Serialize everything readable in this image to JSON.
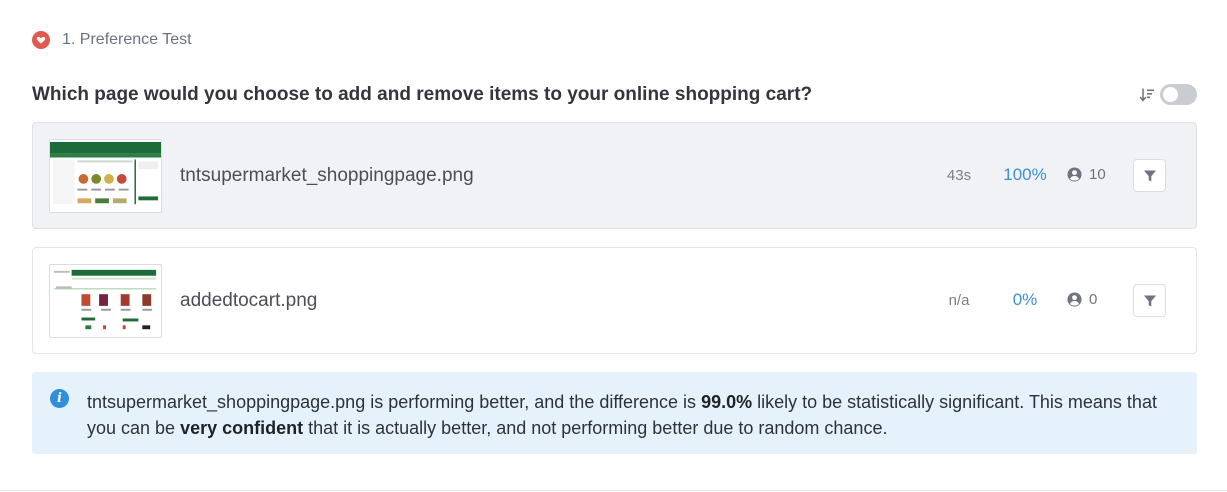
{
  "header": {
    "icon": "heart-icon",
    "label": "1. Preference Test",
    "accent": "#e2594e"
  },
  "question": "Which page would you choose to add and remove items to your online shopping cart?",
  "controls": {
    "sort_icon": "sort-descending-icon",
    "toggle_on": false
  },
  "options": [
    {
      "filename": "tntsupermarket_shoppingpage.png",
      "time": "43s",
      "percent": "100%",
      "count": "10",
      "selected": true
    },
    {
      "filename": "addedtocart.png",
      "time": "n/a",
      "percent": "0%",
      "count": "0",
      "selected": false
    }
  ],
  "info": {
    "icon": "info-icon",
    "part1": "tntsupermarket_shoppingpage.png is performing better, and the difference is ",
    "highlight1": "99.0%",
    "part2": " likely to be statistically significant. This means that you can be ",
    "highlight2": "very confident",
    "part3": " that it is actually better, and not performing better due to random chance."
  },
  "colors": {
    "percent": "#3d8fd6",
    "info_bg": "#e5f2fb",
    "brand_green": "#1e6b3a"
  }
}
